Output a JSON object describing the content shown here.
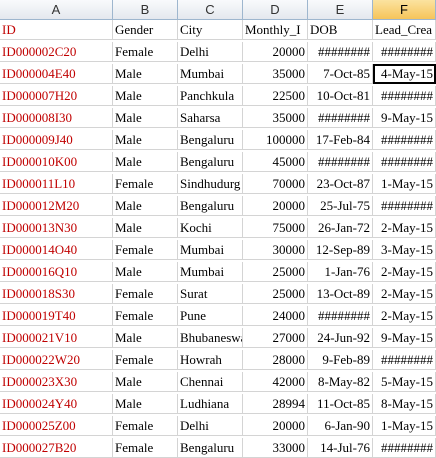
{
  "columns": [
    "A",
    "B",
    "C",
    "D",
    "E",
    "F"
  ],
  "active_column": "F",
  "header": [
    "ID",
    "Gender",
    "City",
    "Monthly_I",
    "DOB",
    "Lead_Crea"
  ],
  "rows": [
    [
      "ID000002C20",
      "Female",
      "Delhi",
      "20000",
      "########",
      "########"
    ],
    [
      "ID000004E40",
      "Male",
      "Mumbai",
      "35000",
      "7-Oct-85",
      "4-May-15"
    ],
    [
      "ID000007H20",
      "Male",
      "Panchkula",
      "22500",
      "10-Oct-81",
      "########"
    ],
    [
      "ID000008I30",
      "Male",
      "Saharsa",
      "35000",
      "########",
      "9-May-15"
    ],
    [
      "ID000009J40",
      "Male",
      "Bengaluru",
      "100000",
      "17-Feb-84",
      "########"
    ],
    [
      "ID000010K00",
      "Male",
      "Bengaluru",
      "45000",
      "########",
      "########"
    ],
    [
      "ID000011L10",
      "Female",
      "Sindhudurg",
      "70000",
      "23-Oct-87",
      "1-May-15"
    ],
    [
      "ID000012M20",
      "Male",
      "Bengaluru",
      "20000",
      "25-Jul-75",
      "########"
    ],
    [
      "ID000013N30",
      "Male",
      "Kochi",
      "75000",
      "26-Jan-72",
      "2-May-15"
    ],
    [
      "ID000014O40",
      "Female",
      "Mumbai",
      "30000",
      "12-Sep-89",
      "3-May-15"
    ],
    [
      "ID000016Q10",
      "Male",
      "Mumbai",
      "25000",
      "1-Jan-76",
      "2-May-15"
    ],
    [
      "ID000018S30",
      "Female",
      "Surat",
      "25000",
      "13-Oct-89",
      "2-May-15"
    ],
    [
      "ID000019T40",
      "Female",
      "Pune",
      "24000",
      "########",
      "2-May-15"
    ],
    [
      "ID000021V10",
      "Male",
      "Bhubaneswar",
      "27000",
      "24-Jun-92",
      "9-May-15"
    ],
    [
      "ID000022W20",
      "Female",
      "Howrah",
      "28000",
      "9-Feb-89",
      "########"
    ],
    [
      "ID000023X30",
      "Male",
      "Chennai",
      "42000",
      "8-May-82",
      "5-May-15"
    ],
    [
      "ID000024Y40",
      "Male",
      "Ludhiana",
      "28994",
      "11-Oct-85",
      "8-May-15"
    ],
    [
      "ID000025Z00",
      "Female",
      "Delhi",
      "20000",
      "6-Jan-90",
      "1-May-15"
    ],
    [
      "ID000027B20",
      "Female",
      "Bengaluru",
      "33000",
      "14-Jul-76",
      "########"
    ]
  ],
  "selected_cell": {
    "row": 2,
    "col": 5
  },
  "colors": {
    "id_text": "#c00000",
    "header_active": "#f6c45a"
  }
}
